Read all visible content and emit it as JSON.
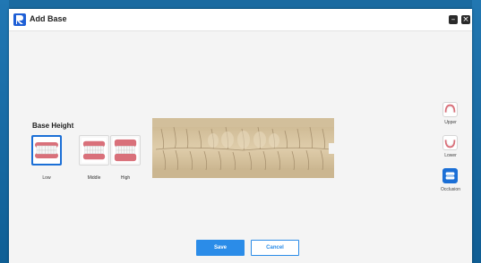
{
  "window": {
    "title": "Add Base",
    "minimize_icon": "minimize-icon",
    "close_icon": "close-icon"
  },
  "base_height": {
    "label": "Base Height",
    "options": [
      {
        "label": "Low",
        "selected": true
      },
      {
        "label": "Middle",
        "selected": false
      },
      {
        "label": "High",
        "selected": false
      }
    ]
  },
  "view_options": [
    {
      "label": "Upper",
      "icon": "upper-jaw-icon",
      "active": false
    },
    {
      "label": "Lower",
      "icon": "lower-jaw-icon",
      "active": false
    },
    {
      "label": "Occlusion",
      "icon": "occlusion-icon",
      "active": true
    }
  ],
  "actions": {
    "save_label": "Save",
    "cancel_label": "Cancel"
  },
  "colors": {
    "accent": "#1b6fd6",
    "button": "#2b8ce8",
    "model": "#d8c6a3"
  }
}
